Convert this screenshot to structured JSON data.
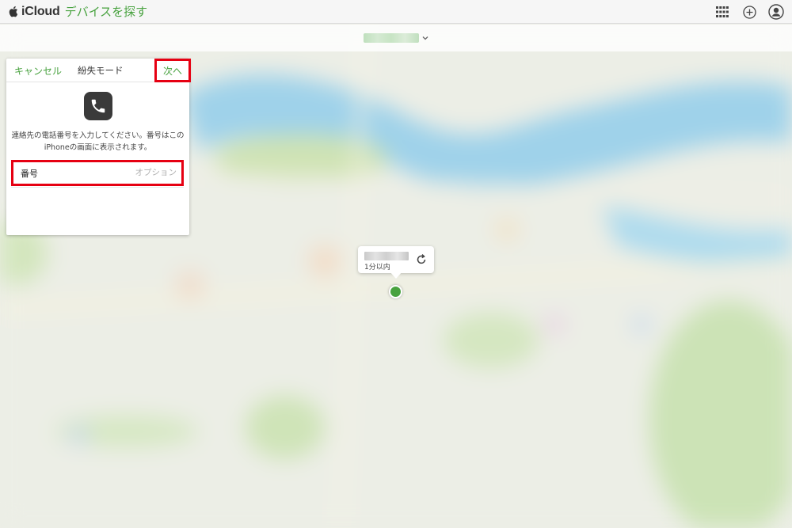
{
  "topbar": {
    "brand": "iCloud",
    "app_title": "デバイスを探す",
    "icons": [
      "apps-grid-icon",
      "add-icon",
      "account-icon"
    ]
  },
  "device_bar": {
    "icons": [
      "chevron-down-icon"
    ]
  },
  "lost_mode_panel": {
    "cancel_label": "キャンセル",
    "title": "紛失モード",
    "next_label": "次へ",
    "icon": "phone-icon",
    "description": "連絡先の電話番号を入力してください。番号はこのiPhoneの画面に表示されます。",
    "number_label": "番号",
    "number_placeholder": "オプション",
    "number_value": "",
    "highlight_color": "#e60012",
    "accent_color": "#48a23f"
  },
  "device_callout": {
    "time": "1分以内",
    "icon": "refresh-icon"
  }
}
